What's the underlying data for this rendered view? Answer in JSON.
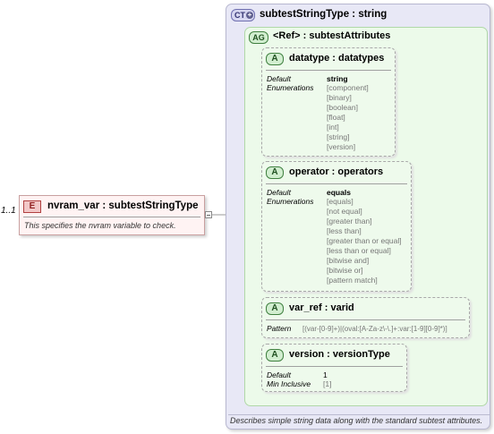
{
  "element": {
    "multiplicity": "1..1",
    "badge": "E",
    "title": "nvram_var  : subtestStringType",
    "description": "This specifies the nvram variable to check."
  },
  "complex_type": {
    "badge": "CT",
    "title": "subtestStringType  : string",
    "description": "Describes simple string data along with the standard subtest attributes."
  },
  "attribute_group": {
    "badge": "AG",
    "title": "<Ref>      : subtestAttributes"
  },
  "attributes": [
    {
      "badge": "A",
      "title": "datatype  : datatypes",
      "default_label": "Default",
      "default_value": "string",
      "enum_label": "Enumerations",
      "enumerations": [
        "[component]",
        "[binary]",
        "[boolean]",
        "[float]",
        "[int]",
        "[string]",
        "[version]"
      ]
    },
    {
      "badge": "A",
      "title": "operator  : operators",
      "default_label": "Default",
      "default_value": "equals",
      "enum_label": "Enumerations",
      "enumerations": [
        "[equals]",
        "[not equal]",
        "[greater than]",
        "[less than]",
        "[greater than or equal]",
        "[less than or equal]",
        "[bitwise and]",
        "[bitwise or]",
        "[pattern match]"
      ]
    },
    {
      "badge": "A",
      "title": "var_ref    : varid",
      "pattern_label": "Pattern",
      "pattern_value": "[(var-[0-9]+)|(oval:[A-Za-z\\-\\.]+:var:[1-9][0-9]*)]"
    },
    {
      "badge": "A",
      "title": "version    : versionType",
      "default_label": "Default",
      "default_value": "1",
      "min_label": "Min Inclusive",
      "min_value": "[1]"
    }
  ]
}
